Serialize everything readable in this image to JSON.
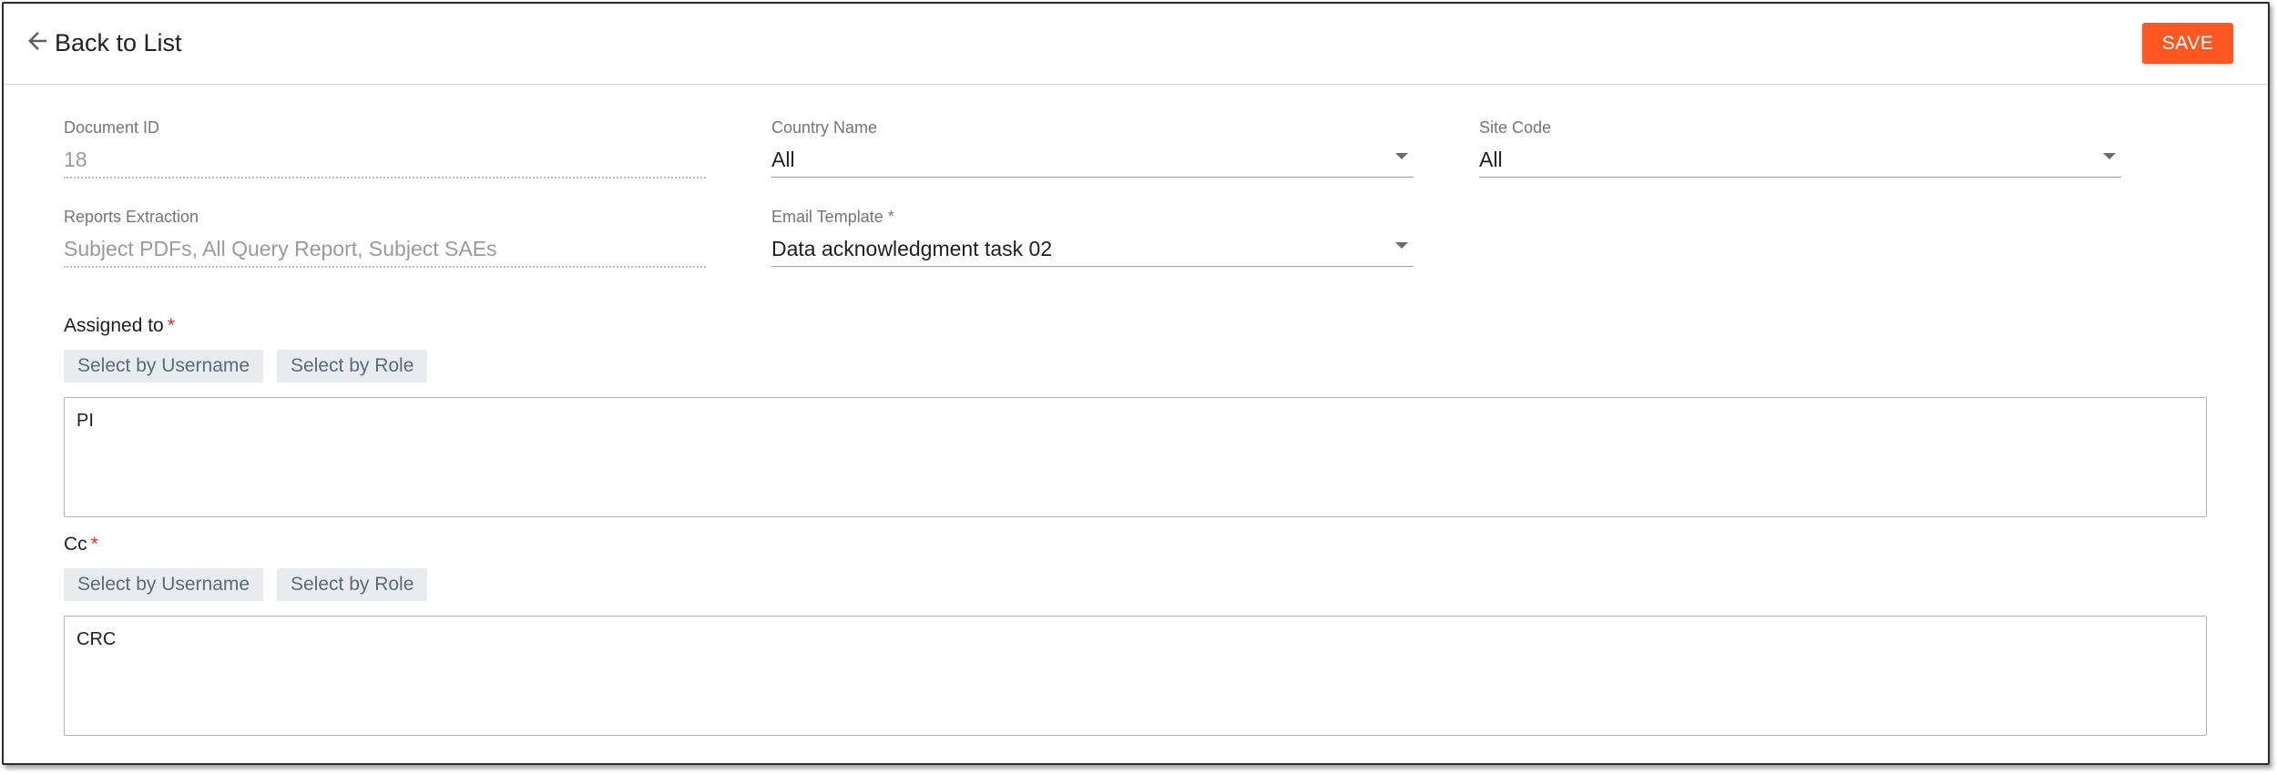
{
  "header": {
    "back_label": "Back to List",
    "save_label": "SAVE"
  },
  "colors": {
    "accent": "#fe5722",
    "chip_bg": "#e9ecef",
    "chip_text": "#546e7a",
    "required": "#d32f2f"
  },
  "fields": {
    "document_id": {
      "label": "Document ID",
      "value": "18"
    },
    "country_name": {
      "label": "Country Name",
      "value": "All"
    },
    "site_code": {
      "label": "Site Code",
      "value": "All"
    },
    "reports_extraction": {
      "label": "Reports Extraction",
      "value": "Subject PDFs, All Query Report, Subject SAEs"
    },
    "email_template": {
      "label": "Email Template *",
      "value": "Data acknowledgment task 02"
    }
  },
  "assigned_to": {
    "label": "Assigned to",
    "required_mark": "*",
    "select_username_label": "Select by Username",
    "select_role_label": "Select by Role",
    "value": "PI"
  },
  "cc": {
    "label": "Cc",
    "required_mark": "*",
    "select_username_label": "Select by Username",
    "select_role_label": "Select by Role",
    "value": "CRC"
  }
}
